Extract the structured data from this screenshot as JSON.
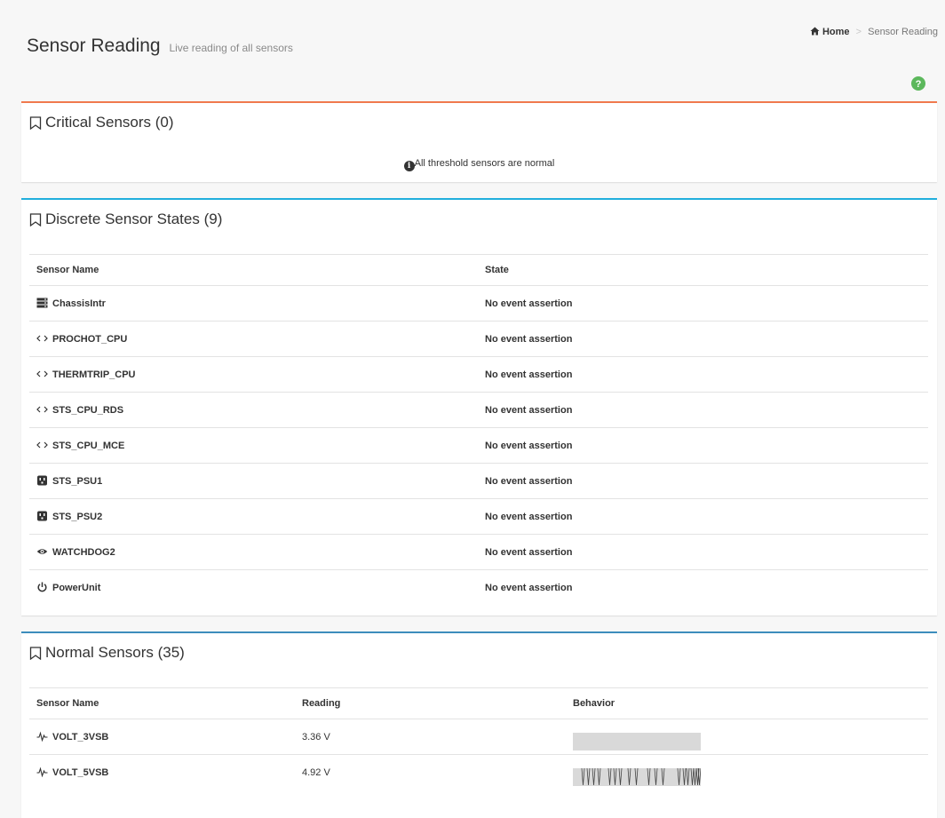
{
  "header": {
    "title": "Sensor Reading",
    "subtitle": "Live reading of all sensors",
    "breadcrumb": {
      "home": "Home",
      "separator": ">",
      "current": "Sensor Reading"
    }
  },
  "critical": {
    "title": "Critical Sensors (0)",
    "message": "All threshold sensors are normal"
  },
  "discrete": {
    "title": "Discrete Sensor States (9)",
    "columns": {
      "name": "Sensor Name",
      "state": "State"
    },
    "rows": [
      {
        "icon": "server-icon",
        "name": "ChassisIntr",
        "state": "No event assertion"
      },
      {
        "icon": "arrows-h-icon",
        "name": "PROCHOT_CPU",
        "state": "No event assertion"
      },
      {
        "icon": "arrows-h-icon",
        "name": "THERMTRIP_CPU",
        "state": "No event assertion"
      },
      {
        "icon": "arrows-h-icon",
        "name": "STS_CPU_RDS",
        "state": "No event assertion"
      },
      {
        "icon": "arrows-h-icon",
        "name": "STS_CPU_MCE",
        "state": "No event assertion"
      },
      {
        "icon": "plug-icon",
        "name": "STS_PSU1",
        "state": "No event assertion"
      },
      {
        "icon": "plug-icon",
        "name": "STS_PSU2",
        "state": "No event assertion"
      },
      {
        "icon": "eye-icon",
        "name": "WATCHDOG2",
        "state": "No event assertion"
      },
      {
        "icon": "power-icon",
        "name": "PowerUnit",
        "state": "No event assertion"
      }
    ]
  },
  "normal": {
    "title": "Normal Sensors (35)",
    "columns": {
      "name": "Sensor Name",
      "reading": "Reading",
      "behavior": "Behavior"
    },
    "rows": [
      {
        "icon": "pulse-icon",
        "name": "VOLT_3VSB",
        "reading": "3.36 V",
        "behavior": "flat"
      },
      {
        "icon": "pulse-icon",
        "name": "VOLT_5VSB",
        "reading": "4.92 V",
        "behavior": "fluctuating"
      }
    ]
  },
  "colors": {
    "critical_accent": "#f07a4e",
    "discrete_accent": "#21aedc",
    "normal_accent": "#3c8dbc",
    "help": "#5cb85c"
  }
}
